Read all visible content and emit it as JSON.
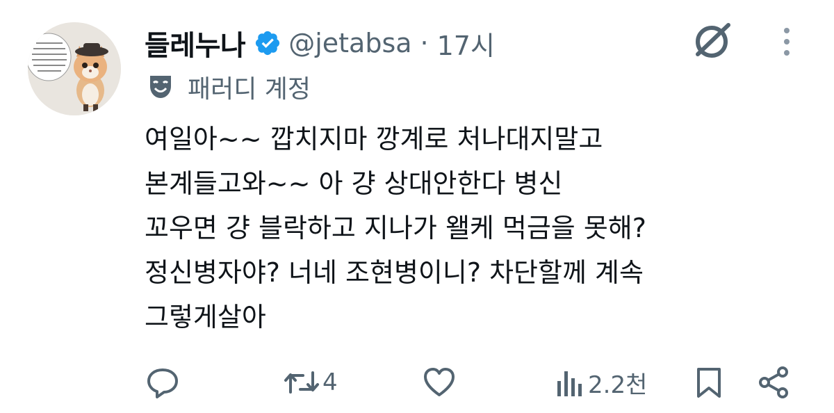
{
  "author": {
    "display_name": "들레누나",
    "verified_color": "#1d9bf0",
    "handle": "@jetabsa",
    "separator": "·",
    "time": "17시",
    "label": "패러디 계정"
  },
  "post": {
    "lines": [
      "여일아~~ 깝치지마 깡계로 처나대지말고",
      "본계들고와~~ 아 걍 상대안한다 병신",
      "꼬우면 걍 블락하고 지나가 왤케 먹금을 못해?",
      "정신병자야? 너네 조현병이니? 차단할께 계속",
      "그렇게살아"
    ]
  },
  "actions": {
    "reply": {
      "icon": "reply-icon",
      "count": ""
    },
    "repost": {
      "icon": "repost-icon",
      "count": "4"
    },
    "like": {
      "icon": "heart-icon",
      "count": ""
    },
    "views": {
      "icon": "views-icon",
      "count": "2.2천"
    },
    "bookmark": {
      "icon": "bookmark-icon"
    },
    "share": {
      "icon": "share-icon"
    }
  },
  "colors": {
    "text": "#0f1419",
    "secondary": "#536471",
    "verified": "#1d9bf0"
  }
}
